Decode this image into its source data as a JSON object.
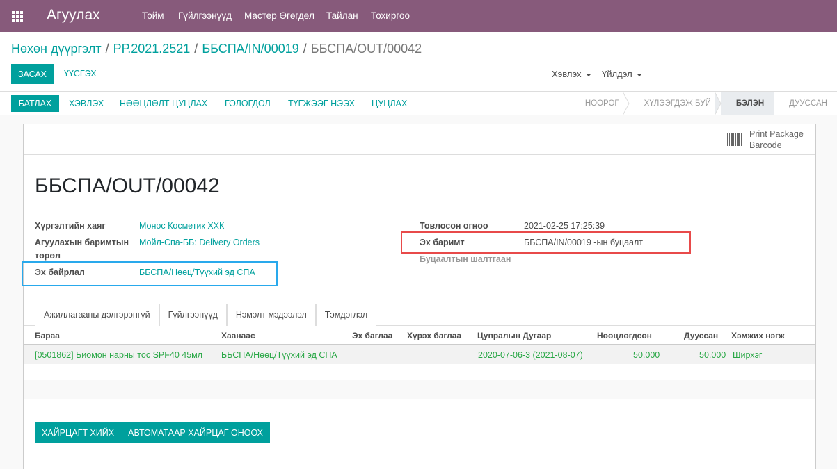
{
  "nav": {
    "brand": "Агуулах",
    "menu": [
      "Тойм",
      "Гүйлгээнүүд",
      "Мастер Өгөгдөл",
      "Тайлан",
      "Тохиргоо"
    ]
  },
  "breadcrumb": {
    "items": [
      "Нөхөн дүүргэлт",
      "РР.2021.2521",
      "ББСПА/IN/00019"
    ],
    "current": "ББСПА/OUT/00042"
  },
  "toolbar": {
    "edit_label": "ЗАСАХ",
    "create_label": "ҮҮСГЭХ",
    "print_label": "Хэвлэх",
    "action_label": "Үйлдэл"
  },
  "statusbar": {
    "confirm_label": "БАТЛАХ",
    "actions": [
      "ХЭВЛЭХ",
      "НӨӨЦЛӨЛТ ЦУЦЛАХ",
      "ГОЛОГДОЛ",
      "ТҮГЖЭЭГ НЭЭХ",
      "ЦУЦЛАХ"
    ],
    "stages": [
      "НООРОГ",
      "ХҮЛЭЭГДЭЖ БУЙ",
      "БЭЛЭН",
      "ДУУССАН"
    ],
    "active_stage": "БЭЛЭН"
  },
  "smart_button": {
    "label_line1": "Print Package",
    "label_line2": "Barcode"
  },
  "record": {
    "title": "ББСПА/OUT/00042",
    "delivery_address_label": "Хүргэлтийн хаяг",
    "delivery_address": "Монос Косметик ХХК",
    "operation_type_label1": "Агуулахын баримтын",
    "operation_type_label2": "төрөл",
    "operation_type": "Мойл-Спа-ББ: Delivery Orders",
    "source_location_label": "Эх байрлал",
    "source_location": "ББСПА/Нөөц/Түүхий эд СПА",
    "scheduled_date_label": "Товлосон огноо",
    "scheduled_date": "2021-02-25 17:25:39",
    "source_document_label": "Эх баримт",
    "source_document": "ББСПА/IN/00019 -ын буцаалт",
    "return_reason_label": "Буцаалтын шалтгаан"
  },
  "tabs": [
    "Ажиллагааны дэлгэрэнгүй",
    "Гүйлгээнүүд",
    "Нэмэлт мэдээлэл",
    "Тэмдэглэл"
  ],
  "table": {
    "headers": [
      "Бараа",
      "Хаанаас",
      "Эх баглаа",
      "Хүрэх баглаа",
      "Цувралын Дугаар",
      "Нөөцлөгдсөн",
      "Дууссан",
      "Хэмжих нэгж"
    ],
    "rows": [
      {
        "product": "[0501862] Биомон нарны тос SPF40 45мл",
        "from": "ББСПА/Нөөц/Түүхий эд СПА",
        "source_package": "",
        "dest_package": "",
        "lot": "2020-07-06-3 (2021-08-07)",
        "reserved": "50.000",
        "done": "50.000",
        "uom": "Ширхэг"
      }
    ]
  },
  "buttons": {
    "put_in_pack": "ХАЙРЦАГТ ХИЙХ",
    "auto_pack": "АВТОМАТААР ХАЙРЦАГ ОНООХ"
  },
  "colors": {
    "topbar": "#875a7b",
    "accent": "#00a09d",
    "highlight_blue": "#29a9ec",
    "highlight_red": "#e84a4a",
    "line_text": "#28a745"
  }
}
